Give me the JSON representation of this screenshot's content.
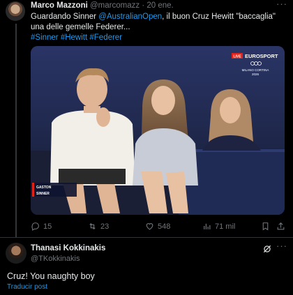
{
  "tweet": {
    "author_name": "Marco Mazzoni",
    "author_handle": "@marcomazz",
    "date": "20 ene.",
    "text_before": "Guardando Sinner ",
    "mention": "@AustralianOpen",
    "text_after": ", il buon Cruz Hewitt \"baccaglia\" una delle gemelle Federer...",
    "hashtags": "#Sinner #Hewitt #Federer",
    "media": {
      "broadcaster": "EUROSPORT",
      "broadcaster_badge": "LIVE",
      "broadcaster_sub": "MILANO CORTINA",
      "broadcaster_year": "2026",
      "score_rows": [
        "GASTON",
        "SINNER"
      ]
    },
    "stats": {
      "replies": "15",
      "reposts": "23",
      "likes": "548",
      "views": "71 mil"
    }
  },
  "reply": {
    "author_name": "Thanasi Kokkinakis",
    "author_handle": "@TKokkinakis",
    "text": "Cruz! You naughty boy",
    "translate_label": "Traducir post"
  },
  "colors": {
    "background": "#000000",
    "text": "#e7e9ea",
    "secondary": "#71767b",
    "link": "#1d9bf0"
  }
}
